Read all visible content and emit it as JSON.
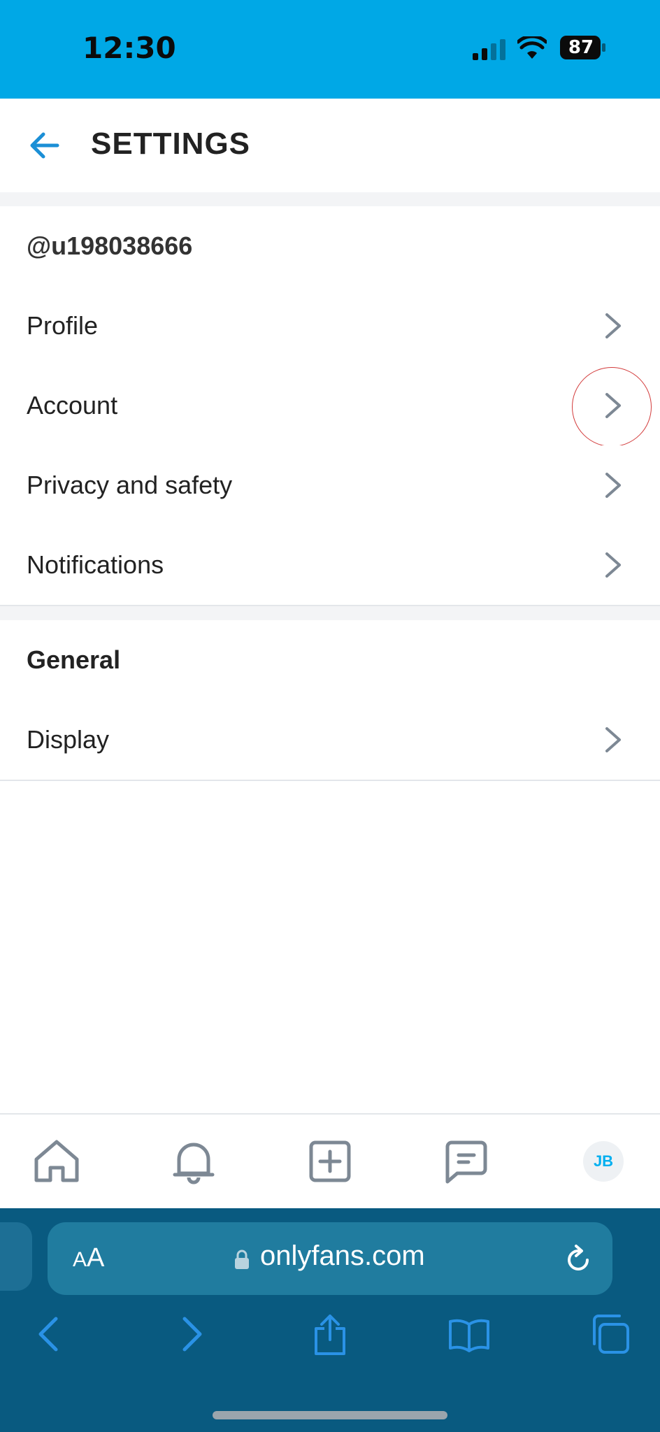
{
  "status": {
    "time": "12:30",
    "battery": "87"
  },
  "header": {
    "title": "SETTINGS"
  },
  "username": "@u198038666",
  "menu": [
    {
      "label": "Profile"
    },
    {
      "label": "Account"
    },
    {
      "label": "Privacy and safety"
    },
    {
      "label": "Notifications"
    }
  ],
  "general": {
    "heading": "General",
    "items": [
      {
        "label": "Display"
      }
    ]
  },
  "tabbar": {
    "avatar_initials": "JB"
  },
  "browser": {
    "aa_small": "A",
    "aa_large": "A",
    "url": "onlyfans.com"
  },
  "colors": {
    "accent": "#00aff0",
    "status_bar": "#00a8e6",
    "browser_bg": "#095a80"
  }
}
